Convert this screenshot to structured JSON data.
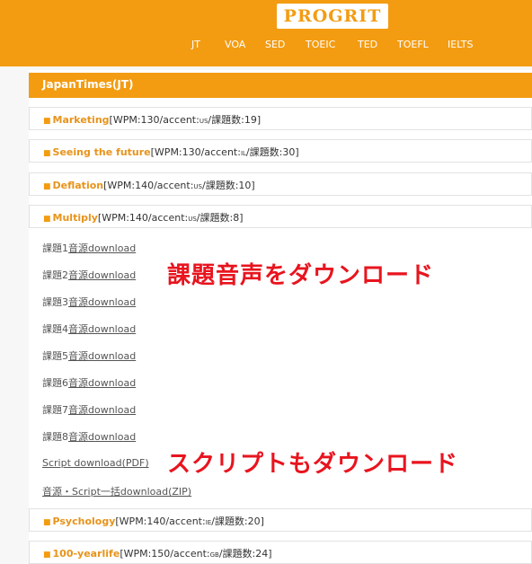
{
  "logo": "PROGRIT",
  "nav": [
    "JT",
    "VOA",
    "SED",
    "TOEIC",
    "TED",
    "TOEFL",
    "IELTS"
  ],
  "section_title": "JapanTimes(JT)",
  "items_top": [
    {
      "title": "Marketing",
      "meta_pre": "[WPM:130/accent:",
      "accent": "US",
      "meta_post": "/課題数:19]"
    },
    {
      "title": "Seeing the future",
      "meta_pre": "[WPM:130/accent:",
      "accent": "IL",
      "meta_post": "/課題数:30]"
    },
    {
      "title": "Deflation",
      "meta_pre": "[WPM:140/accent:",
      "accent": "US",
      "meta_post": "/課題数:10]"
    },
    {
      "title": "Multiply",
      "meta_pre": "[WPM:140/accent:",
      "accent": "US",
      "meta_post": "/課題数:8]"
    }
  ],
  "downloads": [
    {
      "prefix": "課題1",
      "link": "音源download"
    },
    {
      "prefix": "課題2",
      "link": "音源download"
    },
    {
      "prefix": "課題3",
      "link": "音源download"
    },
    {
      "prefix": "課題4",
      "link": "音源download"
    },
    {
      "prefix": "課題5",
      "link": "音源download"
    },
    {
      "prefix": "課題6",
      "link": "音源download"
    },
    {
      "prefix": "課題7",
      "link": "音源download"
    },
    {
      "prefix": "課題8",
      "link": "音源download"
    }
  ],
  "script_link": "Script download(PDF)",
  "zip_link": "音源・Script一括download(ZIP)",
  "items_bottom": [
    {
      "title": "Psychology",
      "meta_pre": "[WPM:140/accent:",
      "accent": "IE",
      "meta_post": "/課題数:20]"
    },
    {
      "title": "100-yearlife",
      "meta_pre": "[WPM:150/accent:",
      "accent": "GB",
      "meta_post": "/課題数:24]"
    }
  ],
  "annotations": {
    "audio": "課題音声をダウンロード",
    "script": "スクリプトもダウンロード"
  },
  "colors": {
    "accent": "#f39c12",
    "annotation": "#e8141e"
  }
}
